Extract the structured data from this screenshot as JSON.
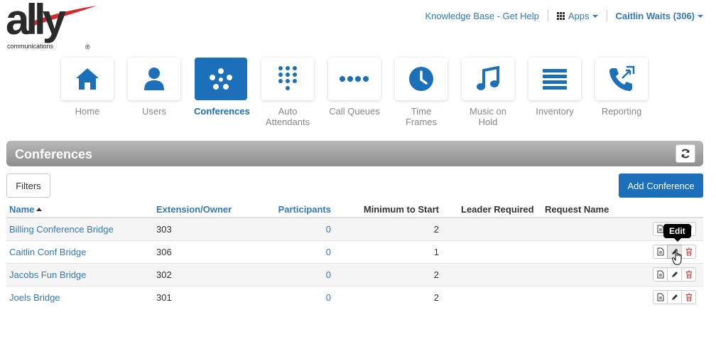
{
  "logo": {
    "word": "ally",
    "sub": "communications",
    "reg": "®"
  },
  "topnav": {
    "help": "Knowledge Base - Get Help",
    "apps": "Apps",
    "user": "Caitlin Waits (306)"
  },
  "tiles": [
    {
      "label": "Home",
      "icon": "home-icon"
    },
    {
      "label": "Users",
      "icon": "user-icon"
    },
    {
      "label": "Conferences",
      "icon": "conference-icon",
      "active": true
    },
    {
      "label": "Auto Attendants",
      "icon": "keypad-icon"
    },
    {
      "label": "Call Queues",
      "icon": "queue-dots-icon"
    },
    {
      "label": "Time Frames",
      "icon": "clock-icon"
    },
    {
      "label": "Music on Hold",
      "icon": "music-note-icon"
    },
    {
      "label": "Inventory",
      "icon": "list-icon"
    },
    {
      "label": "Reporting",
      "icon": "phone-arrows-icon"
    }
  ],
  "section": {
    "title": "Conferences"
  },
  "buttons": {
    "filters": "Filters",
    "add": "Add Conference"
  },
  "table": {
    "headers": [
      "Name",
      "Extension/Owner",
      "Participants",
      "Minimum to Start",
      "Leader Required",
      "Request Name"
    ],
    "rows": [
      {
        "name": "Billing Conference Bridge",
        "ext": "303",
        "participants": "0",
        "min": "2",
        "leader": "",
        "request": ""
      },
      {
        "name": "Caitlin Conf Bridge",
        "ext": "306",
        "participants": "0",
        "min": "1",
        "leader": "",
        "request": ""
      },
      {
        "name": "Jacobs Fun Bridge",
        "ext": "302",
        "participants": "0",
        "min": "2",
        "leader": "",
        "request": ""
      },
      {
        "name": "Joels Bridge",
        "ext": "301",
        "participants": "0",
        "min": "2",
        "leader": "",
        "request": ""
      }
    ]
  },
  "tooltip": "Edit",
  "colors": {
    "brand_blue": "#1b70b9",
    "link_blue": "#337ab7",
    "logo_red": "#d7282f",
    "delete_red": "#c9302c"
  }
}
